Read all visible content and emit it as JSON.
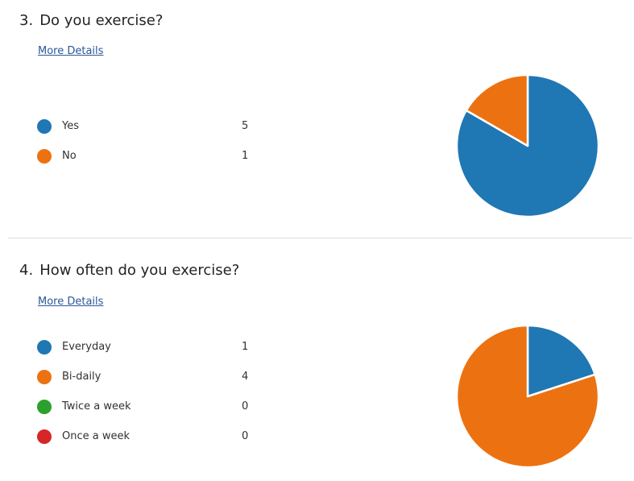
{
  "more_details_label": "More Details",
  "colors": {
    "blue": "#1f77b4",
    "orange": "#ec7211",
    "green": "#2ca02c",
    "red": "#d62728"
  },
  "chart_data": [
    {
      "type": "pie",
      "number": "3.",
      "title": "Do you exercise?",
      "categories": [
        "Yes",
        "No"
      ],
      "values": [
        5,
        1
      ],
      "colors": [
        "#1f77b4",
        "#ec7211"
      ],
      "legend_placement": "left"
    },
    {
      "type": "pie",
      "number": "4.",
      "title": "How often do you exercise?",
      "categories": [
        "Everyday",
        "Bi-daily",
        "Twice a week",
        "Once a week"
      ],
      "values": [
        1,
        4,
        0,
        0
      ],
      "colors": [
        "#1f77b4",
        "#ec7211",
        "#2ca02c",
        "#d62728"
      ],
      "legend_placement": "left"
    }
  ]
}
